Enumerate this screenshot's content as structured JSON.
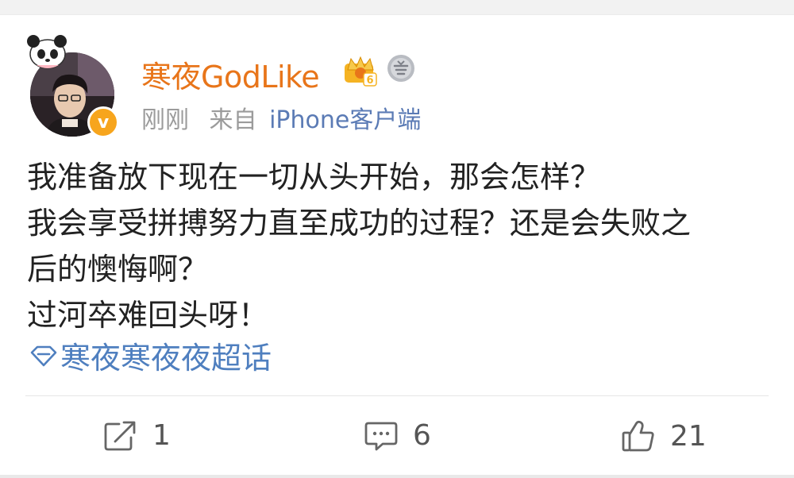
{
  "post": {
    "username": "寒夜GodLike",
    "time": "刚刚",
    "source_prefix": "来自",
    "source": "iPhone客户端",
    "verified_mark": "v",
    "level_badge_num": "6",
    "body_lines": [
      "我准备放下现在一切从头开始，那会怎样？",
      "我会享受拼搏努力直至成功的过程？还是会失败之",
      "后的懊悔啊？",
      "过河卒难回头呀！"
    ],
    "topic": "寒夜寒夜夜超话",
    "actions": {
      "repost_count": "1",
      "comment_count": "6",
      "like_count": "21"
    }
  },
  "colors": {
    "username": "#e8751a",
    "link": "#5b7bb5",
    "topic": "#4f7fbf",
    "meta": "#9b9b9b",
    "verified": "#f7a51d"
  },
  "icons": {
    "avatar_overlay": "panda-icon",
    "verified": "verified-v-icon",
    "membership": "crown-badge-icon",
    "answer": "answer-badge-icon",
    "topic": "diamond-icon",
    "repost": "repost-icon",
    "comment": "comment-icon",
    "like": "thumbs-up-icon"
  }
}
